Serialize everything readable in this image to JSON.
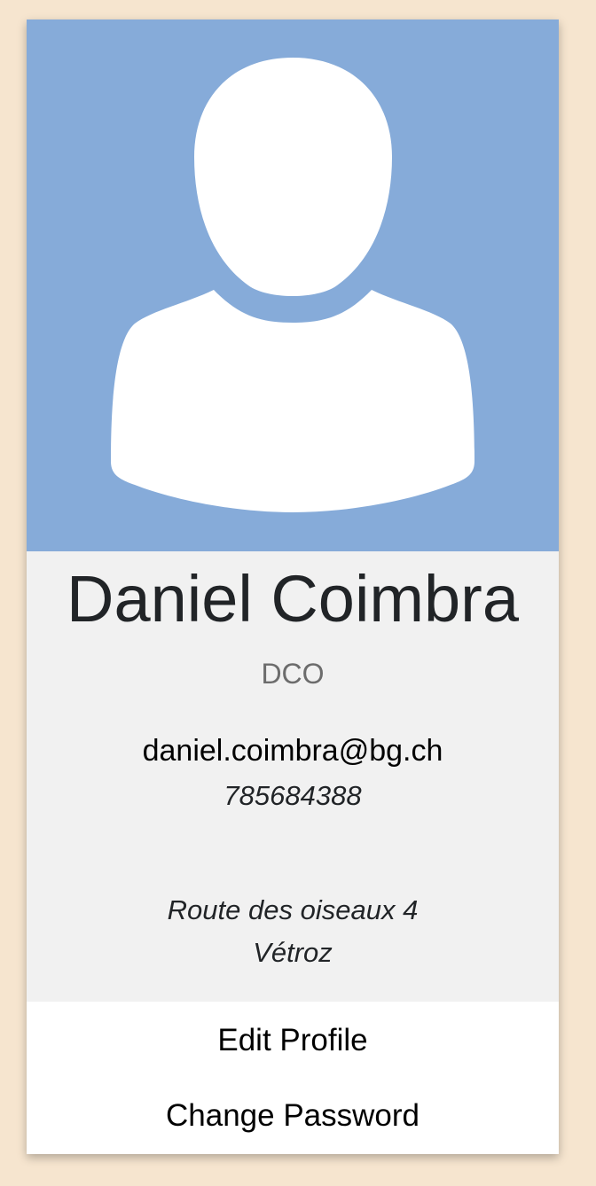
{
  "profile": {
    "name": "Daniel Coimbra",
    "initials": "DCO",
    "email": "daniel.coimbra@bg.ch",
    "phone": "785684388",
    "address": {
      "street": "Route des oiseaux 4",
      "city": "Vétroz"
    },
    "avatar_icon": "user-silhouette-icon"
  },
  "actions": {
    "edit_profile": "Edit Profile",
    "change_password": "Change Password"
  },
  "colors": {
    "page_background": "#f6e5cf",
    "avatar_background": "#86abd9",
    "info_background": "#f1f1f1",
    "initials_text": "#6c6c6c"
  }
}
